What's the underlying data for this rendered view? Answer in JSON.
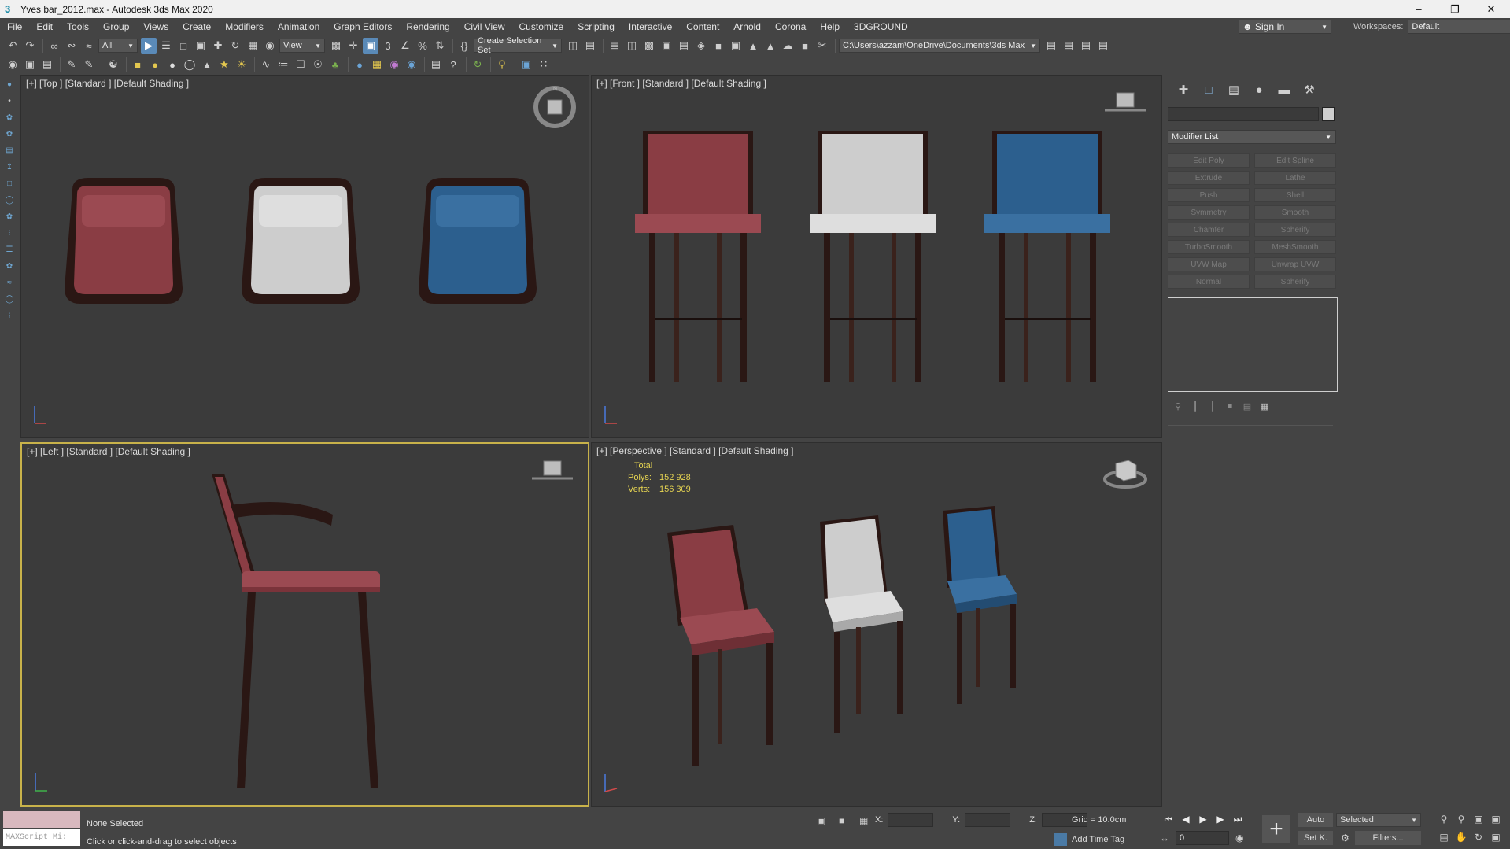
{
  "window": {
    "title": "Yves bar_2012.max - Autodesk 3ds Max 2020",
    "app_icon": "3ds-max-icon",
    "controls": [
      "minimize-icon",
      "restore-icon",
      "close-icon"
    ]
  },
  "menu": {
    "items": [
      "File",
      "Edit",
      "Tools",
      "Group",
      "Views",
      "Create",
      "Modifiers",
      "Animation",
      "Graph Editors",
      "Rendering",
      "Civil View",
      "Customize",
      "Scripting",
      "Interactive",
      "Content",
      "Arnold",
      "Corona",
      "Help",
      "3DGROUND"
    ],
    "sign_in": "Sign In",
    "workspaces_label": "Workspaces:",
    "workspace_value": "Default"
  },
  "toolbar": {
    "selection_filter": "All",
    "reference_coord": "View",
    "selection_set": "Create Selection Set",
    "project_path": "C:\\Users\\azzam\\OneDrive\\Documents\\3ds Max 2020"
  },
  "viewports": {
    "top": {
      "label": "[+] [Top ] [Standard ] [Default Shading ]"
    },
    "front": {
      "label": "[+] [Front ] [Standard ] [Default Shading ]"
    },
    "left": {
      "label": "[+] [Left ] [Standard ] [Default Shading ]"
    },
    "perspective": {
      "label": "[+] [Perspective ] [Standard ] [Default Shading ]",
      "stats_title": "Total",
      "polys_label": "Polys:",
      "polys_value": "152 928",
      "verts_label": "Verts:",
      "verts_value": "156 309"
    }
  },
  "chairs": {
    "colors": {
      "red": "#8a3d44",
      "white": "#d2d2d2",
      "blue": "#2c5f8e",
      "wood": "#2a1714"
    }
  },
  "command_panel": {
    "tabs": [
      "create-icon",
      "modify-icon",
      "hierarchy-icon",
      "motion-icon",
      "display-icon",
      "utilities-icon"
    ],
    "modifier_list": "Modifier List",
    "modifier_buttons": [
      "Edit Poly",
      "Edit Spline",
      "Extrude",
      "Lathe",
      "Push",
      "Shell",
      "Symmetry",
      "Smooth",
      "Chamfer",
      "Spherify",
      "TurboSmooth",
      "MeshSmooth",
      "UVW Map",
      "Unwrap UVW",
      "Normal",
      "Spherify"
    ]
  },
  "status": {
    "maxscript_placeholder": "MAXScript Mi:",
    "selection": "None Selected",
    "prompt": "Click or click-and-drag to select objects",
    "x_label": "X:",
    "y_label": "Y:",
    "z_label": "Z:",
    "grid": "Grid = 10.0cm",
    "add_time_tag": "Add Time Tag",
    "frame": "0",
    "auto": "Auto",
    "set_key": "Set K.",
    "selected": "Selected",
    "filters": "Filters..."
  }
}
